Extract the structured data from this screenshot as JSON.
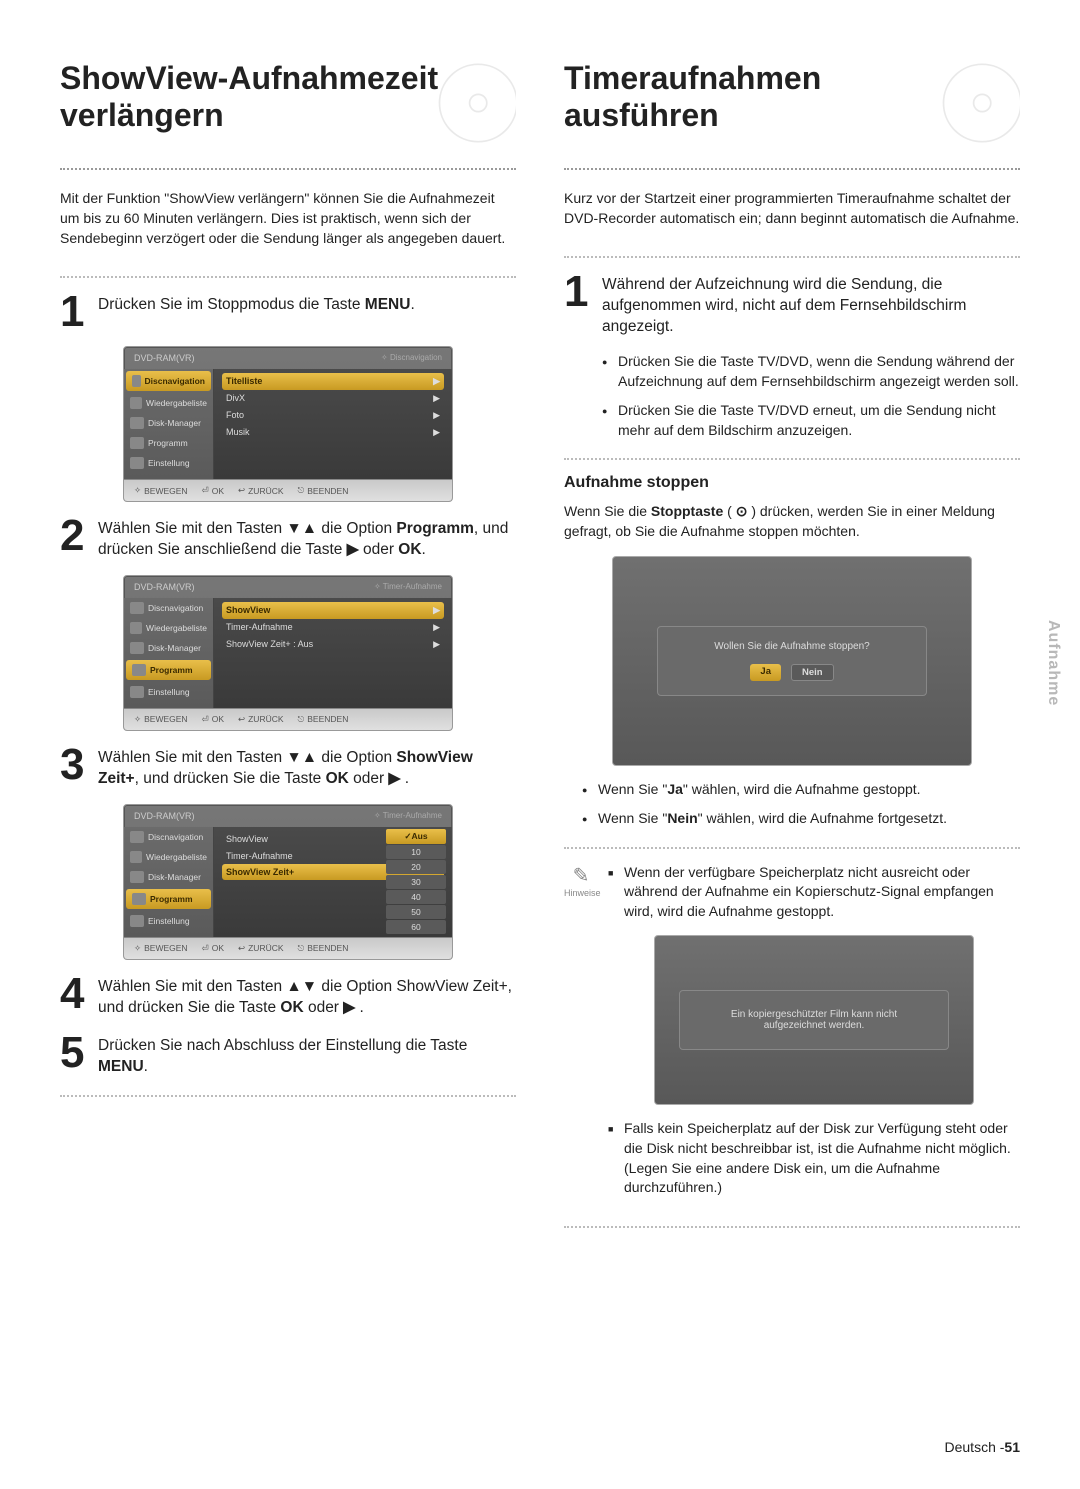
{
  "side_tab": "Aufnahme",
  "left": {
    "title_line1": "ShowView-Aufnahmezeit",
    "title_line2": "verlängern",
    "intro": "Mit der Funktion \"ShowView verlängern\" können Sie die Aufnahmezeit um bis zu 60 Minuten verlängern. Dies ist praktisch, wenn sich der Sendebeginn verzögert oder die Sendung länger als angegeben dauert.",
    "step1_a": "Drücken Sie im Stoppmodus die Taste ",
    "step1_b": "MENU",
    "step1_c": ".",
    "step2_a": "Wählen Sie mit den Tasten ",
    "arrows_ud": "▼▲",
    "step2_b": " die Option ",
    "step2_prog": "Programm",
    "step2_c": ", und drücken Sie anschließend die Taste ",
    "arrow_r": "▶",
    "step2_d": " oder ",
    "ok": "OK",
    "step2_e": ".",
    "step3_a": "Wählen Sie mit den Tasten ",
    "step3_b": " die Option ",
    "step3_sv": "ShowView Zeit+",
    "step3_c": ", und drücken Sie die Taste ",
    "step3_d": " oder ",
    "step3_e": " .",
    "step4_a": "Wählen Sie mit den Tasten ",
    "arrows_du": "▲▼",
    "step4_b": " die Option ShowView Zeit+, und drücken Sie die Taste ",
    "step4_d": " oder ",
    "step4_e": " .",
    "step5_a": "Drücken Sie nach Abschluss der Einstellung die Taste ",
    "step5_menu": "MENU",
    "step5_b": "."
  },
  "right": {
    "title_line1": "Timeraufnahmen",
    "title_line2": "ausführen",
    "intro": "Kurz vor der Startzeit einer programmierten Timeraufnahme schaltet der DVD-Recorder automatisch ein; dann beginnt automatisch die Aufnahme.",
    "step1_text": "Während der Aufzeichnung wird die Sendung, die aufgenommen wird, nicht auf dem Fernsehbildschirm angezeigt.",
    "b1": "Drücken Sie die Taste TV/DVD, wenn die Sendung während der Aufzeichnung auf dem Fernsehbildschirm angezeigt werden soll.",
    "b2": "Drücken Sie die Taste TV/DVD erneut, um die Sendung nicht mehr auf dem Bildschirm anzuzeigen.",
    "stop_heading": "Aufnahme stoppen",
    "stop_p_a": "Wenn Sie die ",
    "stop_p_b": "Stopptaste",
    "stop_p_c": " ( ",
    "stop_glyph": "⊙",
    "stop_p_d": " ) drücken, werden Sie in einer Meldung gefragt, ob Sie die Aufnahme stoppen möchten.",
    "dialog1_msg": "Wollen Sie die Aufnahme stoppen?",
    "dialog1_yes": "Ja",
    "dialog1_no": "Nein",
    "post_b1_a": "Wenn Sie \"",
    "post_b1_ja": "Ja",
    "post_b1_b": "\" wählen, wird die Aufnahme gestoppt.",
    "post_b2_a": "Wenn Sie \"",
    "post_b2_nein": "Nein",
    "post_b2_b": "\" wählen, wird die Aufnahme fortgesetzt.",
    "note_label": "Hinweise",
    "note_sq1": "Wenn der verfügbare Speicherplatz nicht ausreicht oder während der Aufnahme ein Kopierschutz-Signal empfangen wird, wird die Aufnahme gestoppt.",
    "dialog2_l1": "Ein kopiergeschützter Film kann nicht",
    "dialog2_l2": "aufgezeichnet werden.",
    "note_sq2": "Falls kein Speicherplatz auf der Disk zur Verfügung steht oder die Disk nicht beschreibbar ist, ist die Aufnahme nicht möglich. (Legen Sie eine andere Disk ein, um die Aufnahme durchzuführen.)"
  },
  "osd": {
    "head_left": "DVD-RAM(VR)",
    "crumb_disc": "Discnavigation",
    "crumb_timer": "Timer-Aufnahme",
    "side": {
      "discnav": "Discnavigation",
      "playlist": "Wiedergabeliste",
      "diskmgr": "Disk-Manager",
      "program": "Programm",
      "setup": "Einstellung"
    },
    "disc_items": {
      "titellist": "Titelliste",
      "divx": "DivX",
      "foto": "Foto",
      "musik": "Musik"
    },
    "prog_items": {
      "showview": "ShowView",
      "timer": "Timer-Aufnahme",
      "svzeit_off": "ShowView Zeit+ : Aus",
      "svzeit": "ShowView Zeit+"
    },
    "sub_options": {
      "aus": "Aus",
      "o10": "10",
      "o20": "20",
      "o30": "30",
      "o40": "40",
      "o50": "50",
      "o60": "60"
    },
    "foot": {
      "move": "BEWEGEN",
      "ok": "OK",
      "back": "ZURÜCK",
      "exit": "BEENDEN"
    }
  },
  "footer_lang": "Deutsch -",
  "footer_page": "51"
}
